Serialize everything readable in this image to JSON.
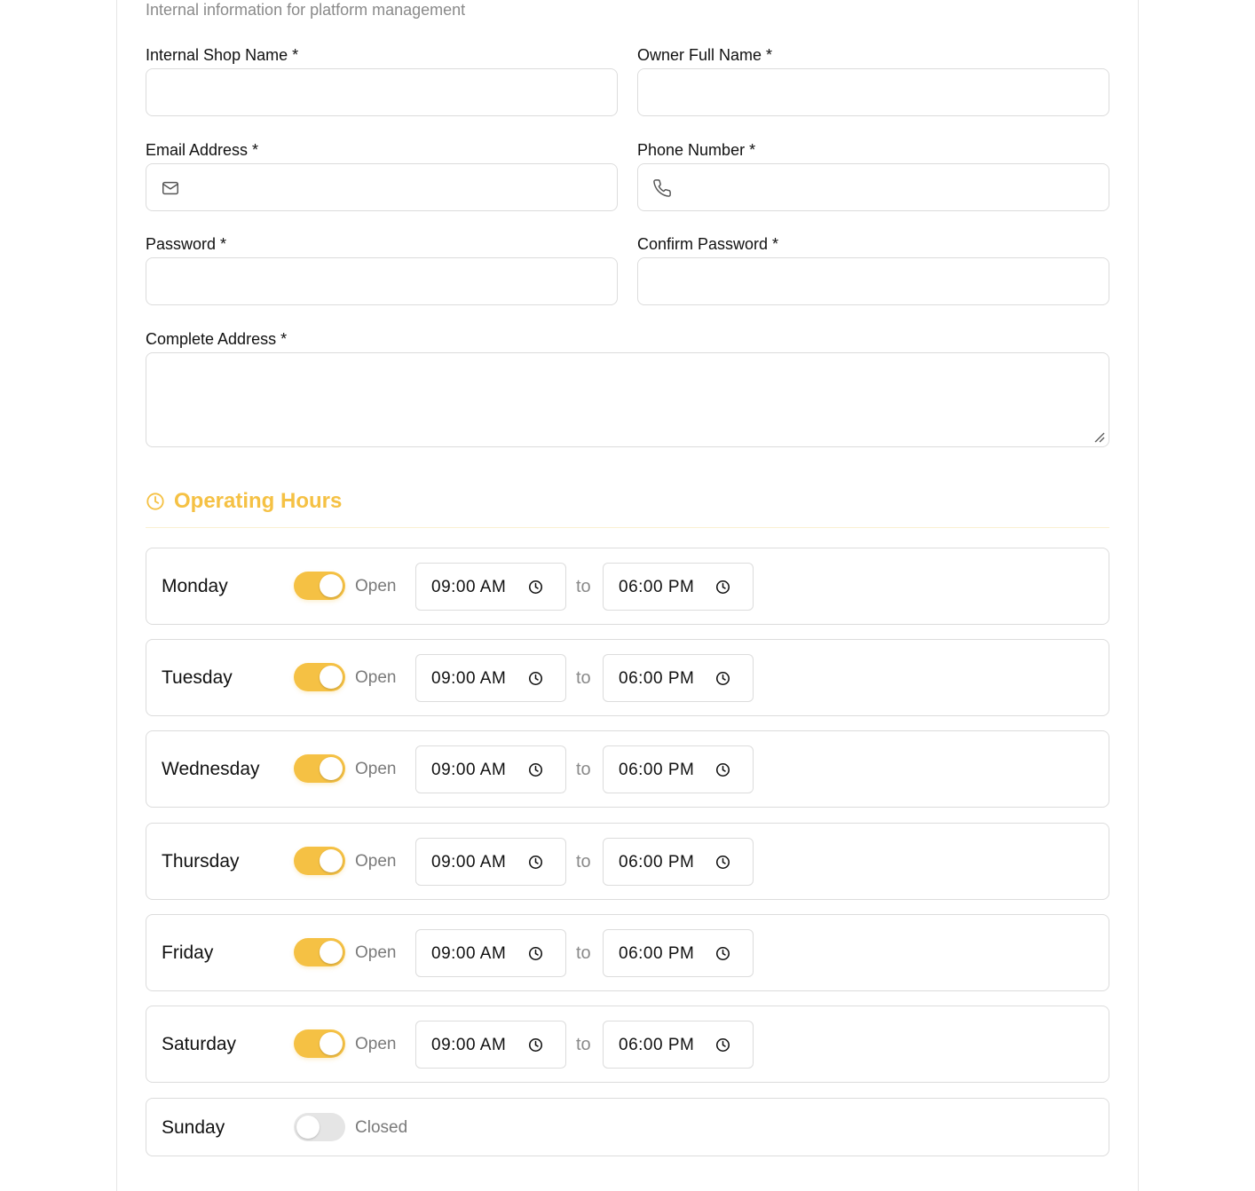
{
  "form": {
    "subtitle": "Internal information for platform management",
    "fields": {
      "shop_name": {
        "label": "Internal Shop Name *",
        "value": ""
      },
      "owner_name": {
        "label": "Owner Full Name *",
        "value": ""
      },
      "email": {
        "label": "Email Address *",
        "value": "",
        "icon": "mail-icon"
      },
      "phone": {
        "label": "Phone Number *",
        "value": "",
        "icon": "phone-icon"
      },
      "password": {
        "label": "Password *",
        "value": ""
      },
      "confirm_password": {
        "label": "Confirm Password *",
        "value": ""
      },
      "address": {
        "label": "Complete Address *",
        "value": ""
      }
    }
  },
  "operating_hours": {
    "title": "Operating Hours",
    "icon": "clock-icon",
    "separator": "to",
    "accent_color": "#f5c144",
    "days": [
      {
        "name": "Monday",
        "status": "Open",
        "open": true,
        "from": "09:00 AM",
        "to": "06:00 PM"
      },
      {
        "name": "Tuesday",
        "status": "Open",
        "open": true,
        "from": "09:00 AM",
        "to": "06:00 PM"
      },
      {
        "name": "Wednesday",
        "status": "Open",
        "open": true,
        "from": "09:00 AM",
        "to": "06:00 PM"
      },
      {
        "name": "Thursday",
        "status": "Open",
        "open": true,
        "from": "09:00 AM",
        "to": "06:00 PM"
      },
      {
        "name": "Friday",
        "status": "Open",
        "open": true,
        "from": "09:00 AM",
        "to": "06:00 PM"
      },
      {
        "name": "Saturday",
        "status": "Open",
        "open": true,
        "from": "09:00 AM",
        "to": "06:00 PM"
      },
      {
        "name": "Sunday",
        "status": "Closed",
        "open": false
      }
    ]
  }
}
